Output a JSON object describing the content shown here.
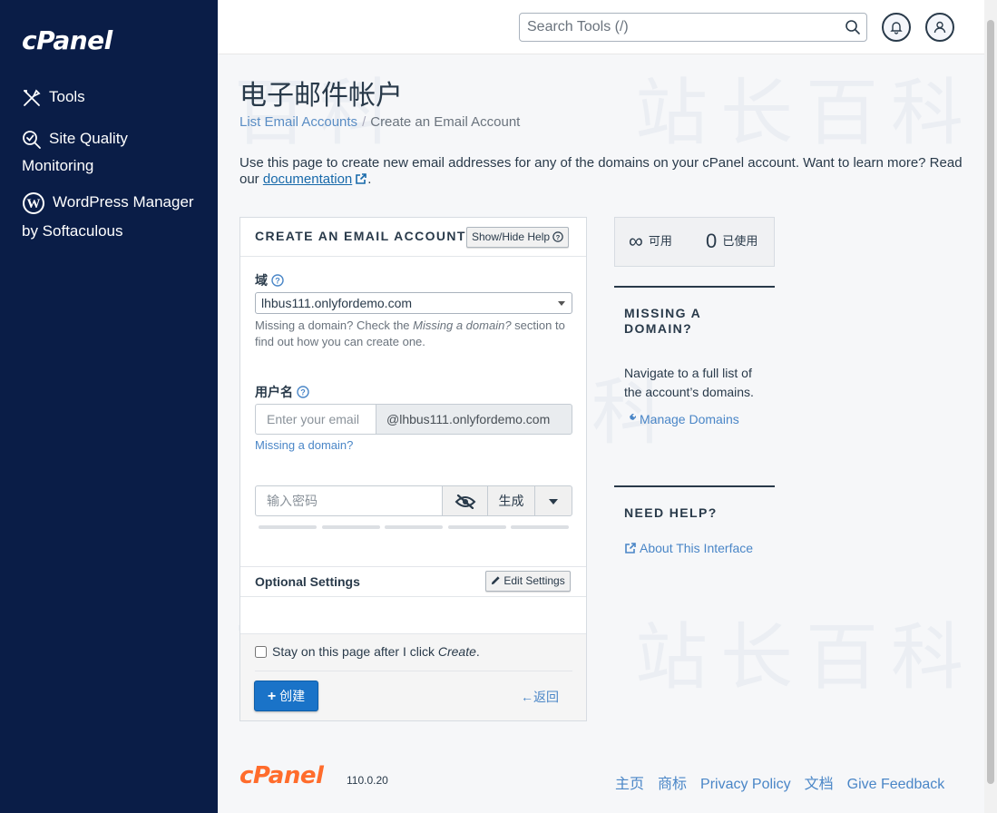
{
  "sidebar": {
    "logo": "cPanel",
    "items": [
      {
        "label": "Tools",
        "icon": "tools-icon"
      },
      {
        "label": "Site Quality",
        "label2": "Monitoring",
        "icon": "site-quality-icon"
      },
      {
        "label": "WordPress Manager",
        "label2": "by Softaculous",
        "icon": "wordpress-icon"
      }
    ]
  },
  "topbar": {
    "search_placeholder": "Search Tools (/)"
  },
  "watermark": "站长百科",
  "page": {
    "title": "电子邮件帐户",
    "breadcrumb": {
      "link": "List Email Accounts",
      "separator": "/",
      "current": "Create an Email Account"
    },
    "intro": "Use this page to create new email addresses for any of the domains on your cPanel account. Want to learn more? Read our ",
    "intro_link": "documentation",
    "intro_end": "."
  },
  "form": {
    "title": "CREATE AN EMAIL ACCOUNT",
    "help_button": "Show/Hide Help",
    "domain_label": "域",
    "domain_value": "lhbus111.onlyfordemo.com",
    "domain_hint_1": "Missing a domain? Check the ",
    "domain_hint_em": "Missing a domain?",
    "domain_hint_2": " section to find out how you can create one.",
    "username_label": "用户名",
    "username_placeholder": "Enter your email",
    "username_suffix": "@lhbus111.onlyfordemo.com",
    "missing_domain_link": "Missing a domain?",
    "password_placeholder": "输入密码",
    "generate_button": "生成",
    "optional_title": "Optional Settings",
    "edit_settings_button": "Edit Settings",
    "stay_label": "Stay on this page after I click ",
    "stay_label_em": "Create",
    "stay_label_end": ".",
    "create_button": "创建",
    "back_link": "返回"
  },
  "stats": {
    "available_symbol": "∞",
    "available_label": "可用",
    "used_value": "0",
    "used_label": "已使用"
  },
  "missing_domain": {
    "title_line1": "MISSING A",
    "title_line2": "DOMAIN?",
    "text": "Navigate to a full list of the account’s domains.",
    "link": "Manage Domains"
  },
  "need_help": {
    "title": "NEED HELP?",
    "link": "About This Interface"
  },
  "footer": {
    "logo": "cPanel",
    "version": "110.0.20",
    "links": [
      "主页",
      "商标",
      "Privacy Policy",
      "文档",
      "Give Feedback"
    ]
  },
  "colors": {
    "sidebar_bg": "#0a1d47",
    "primary": "#1a73c8",
    "link": "#4a86c7",
    "brand_orange": "#ff6c2c"
  }
}
